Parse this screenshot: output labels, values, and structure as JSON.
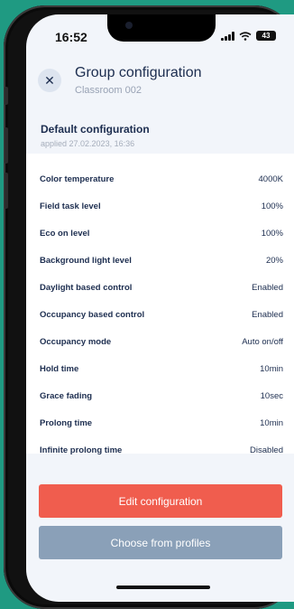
{
  "status": {
    "time": "16:52",
    "battery": "43"
  },
  "header": {
    "title": "Group configuration",
    "subtitle": "Classroom 002"
  },
  "config": {
    "title": "Default configuration",
    "applied": "applied 27.02.2023, 16:36"
  },
  "settings": [
    {
      "label": "Color temperature",
      "value": "4000K"
    },
    {
      "label": "Field task level",
      "value": "100%"
    },
    {
      "label": "Eco on level",
      "value": "100%"
    },
    {
      "label": "Background light level",
      "value": "20%"
    },
    {
      "label": "Daylight based control",
      "value": "Enabled"
    },
    {
      "label": "Occupancy based control",
      "value": "Enabled"
    },
    {
      "label": "Occupancy mode",
      "value": "Auto on/off"
    },
    {
      "label": "Hold time",
      "value": "10min"
    },
    {
      "label": "Grace fading",
      "value": "10sec"
    },
    {
      "label": "Prolong time",
      "value": "10min"
    },
    {
      "label": "Infinite prolong time",
      "value": "Disabled"
    }
  ],
  "actions": {
    "edit": "Edit configuration",
    "profiles": "Choose from profiles"
  },
  "colors": {
    "accent": "#f05d4e",
    "secondary": "#8aa0b8",
    "text": "#1c2d4f"
  }
}
